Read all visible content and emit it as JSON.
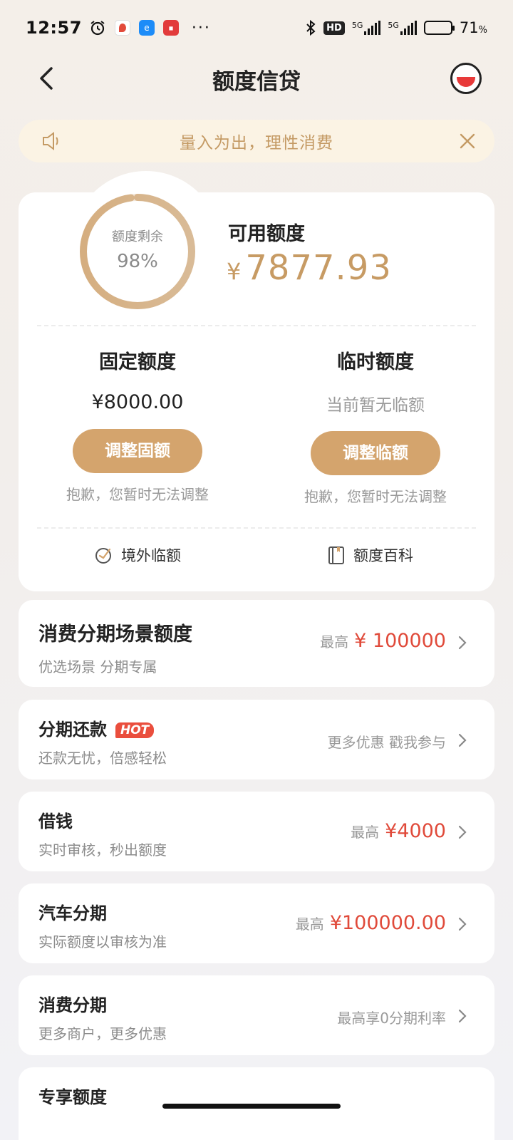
{
  "status_bar": {
    "time": "12:57",
    "icons": [
      "alarm-icon",
      "map-app-icon",
      "browser-app-icon",
      "news-app-icon",
      "more-icon"
    ],
    "network_left": "5G",
    "network_right": "5G",
    "hd_badge": "HD",
    "battery_percent": 71,
    "battery_text": "71",
    "battery_symbol": "%"
  },
  "nav": {
    "title": "额度信贷"
  },
  "notice": {
    "text": "量入为出，理性消费"
  },
  "credit_card": {
    "ring_label": "额度剩余",
    "ring_percent_text": "98%",
    "ring_fraction": 0.98,
    "available_label": "可用额度",
    "available_currency": "¥",
    "available_amount": "7877.93",
    "fixed": {
      "title": "固定额度",
      "value": "¥8000.00",
      "button": "调整固额",
      "note": "抱歉，您暂时无法调整"
    },
    "temporary": {
      "title": "临时额度",
      "value": "当前暂无临额",
      "button": "调整临额",
      "note": "抱歉，您暂时无法调整"
    },
    "tools": [
      {
        "label": "境外临额",
        "icon": "globe-plane-icon"
      },
      {
        "label": "额度百科",
        "icon": "book-icon"
      }
    ]
  },
  "list": [
    {
      "title": "消费分期场景额度",
      "subtitle": "优选场景 分期专属",
      "right_prefix": "最高",
      "right_value": "¥ 100000"
    },
    {
      "title": "分期还款",
      "badge": "HOT",
      "subtitle": "还款无忧，倍感轻松",
      "right_text": "更多优惠 戳我参与"
    },
    {
      "title": "借钱",
      "subtitle": "实时审核，秒出额度",
      "right_prefix": "最高",
      "right_value": "¥4000"
    },
    {
      "title": "汽车分期",
      "subtitle": "实际额度以审核为准",
      "right_prefix": "最高",
      "right_value": "¥100000.00"
    },
    {
      "title": "消费分期",
      "subtitle": "更多商户，更多优惠",
      "right_text": "最高享0分期利率"
    },
    {
      "title": "专享额度"
    }
  ],
  "colors": {
    "accent_gold": "#d4a46d",
    "amount_gold": "#c79b64",
    "value_red": "#e04a3a",
    "notice_bg": "#fbf3e4"
  }
}
